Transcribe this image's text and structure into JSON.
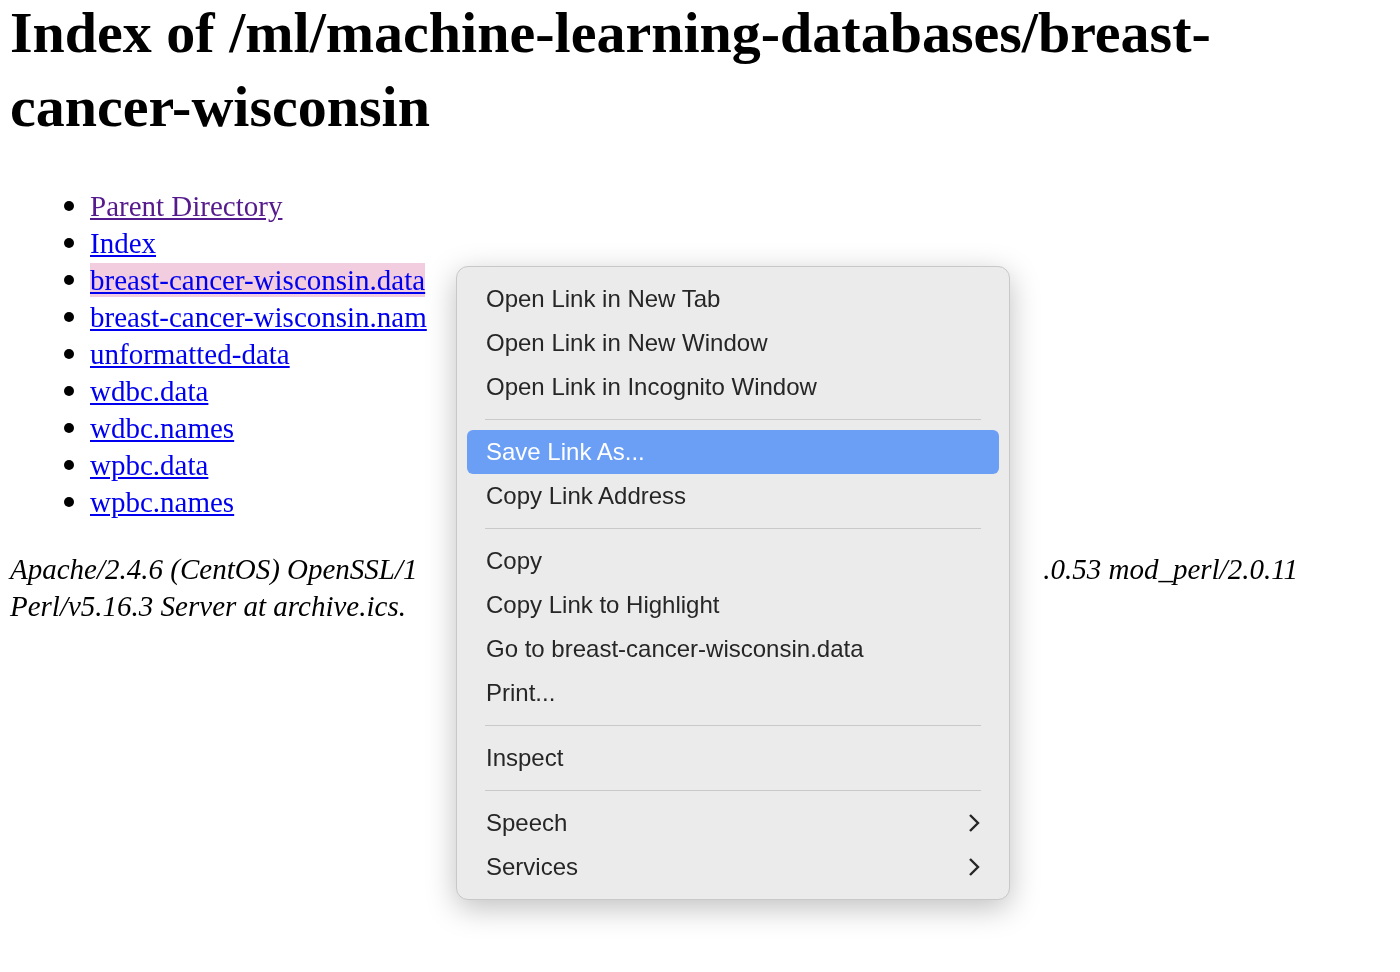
{
  "heading": "Index of /ml/machine-learning-databases/breast-cancer-wisconsin",
  "links": [
    {
      "text": "Parent Directory",
      "visited": true,
      "selected": false
    },
    {
      "text": "Index",
      "visited": false,
      "selected": false
    },
    {
      "text": "breast-cancer-wisconsin.data",
      "visited": false,
      "selected": true
    },
    {
      "text": "breast-cancer-wisconsin.nam",
      "visited": false,
      "selected": false
    },
    {
      "text": "unformatted-data",
      "visited": false,
      "selected": false
    },
    {
      "text": "wdbc.data",
      "visited": false,
      "selected": false
    },
    {
      "text": "wdbc.names",
      "visited": false,
      "selected": false
    },
    {
      "text": "wpbc.data",
      "visited": false,
      "selected": false
    },
    {
      "text": "wpbc.names",
      "visited": false,
      "selected": false
    }
  ],
  "footer": {
    "line_1_left": "Apache/2.4.6 (CentOS) OpenSSL/1",
    "line_1_right": ".0.53 mod_perl/2.0.11",
    "line_2_left": "Perl/v5.16.3 Server at archive.ics."
  },
  "context_menu": {
    "groups": [
      [
        {
          "label": "Open Link in New Tab",
          "selected": false,
          "submenu": false
        },
        {
          "label": "Open Link in New Window",
          "selected": false,
          "submenu": false
        },
        {
          "label": "Open Link in Incognito Window",
          "selected": false,
          "submenu": false
        }
      ],
      [
        {
          "label": "Save Link As...",
          "selected": true,
          "submenu": false
        },
        {
          "label": "Copy Link Address",
          "selected": false,
          "submenu": false
        }
      ],
      [
        {
          "label": "Copy",
          "selected": false,
          "submenu": false
        },
        {
          "label": "Copy Link to Highlight",
          "selected": false,
          "submenu": false
        },
        {
          "label": "Go to breast-cancer-wisconsin.data",
          "selected": false,
          "submenu": false
        },
        {
          "label": "Print...",
          "selected": false,
          "submenu": false
        }
      ],
      [
        {
          "label": "Inspect",
          "selected": false,
          "submenu": false
        }
      ],
      [
        {
          "label": "Speech",
          "selected": false,
          "submenu": true
        },
        {
          "label": "Services",
          "selected": false,
          "submenu": true
        }
      ]
    ]
  }
}
